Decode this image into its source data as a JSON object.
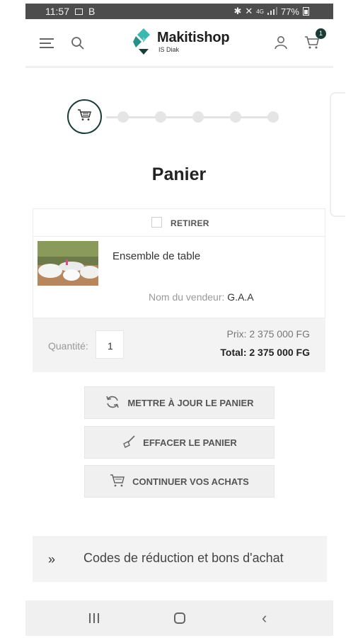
{
  "status_bar": {
    "time": "11:57",
    "carrier_badge": "B",
    "signal_text": "4G",
    "battery": "77%"
  },
  "header": {
    "brand_name": "Makitishop",
    "brand_sub": "IS Diak",
    "cart_count": "1",
    "icons": [
      "menu-icon",
      "search-icon",
      "user-icon",
      "cart-icon"
    ]
  },
  "stepper": {
    "total_steps": 7,
    "active_step": 1
  },
  "page": {
    "title": "Panier"
  },
  "cart_item": {
    "remove_label": "RETIRER",
    "product_name": "Ensemble de table",
    "vendor_label": "Nom du vendeur:",
    "vendor_name": "G.A.A",
    "quantity_label": "Quantité:",
    "quantity_value": "1",
    "price": "Prix: 2 375 000 FG",
    "total": "Total: 2 375 000 FG"
  },
  "actions": {
    "update_label": "METTRE À JOUR LE PANIER",
    "clear_label": "EFFACER LE PANIER",
    "continue_label": "CONTINUER VOS ACHATS"
  },
  "coupons": {
    "chevron": "»",
    "label": "Codes de réduction et bons d'achat"
  },
  "colors": {
    "accent": "#1b3b36",
    "logo_teal": "#3bb8b0",
    "panel_bg": "#f3f3f3"
  }
}
